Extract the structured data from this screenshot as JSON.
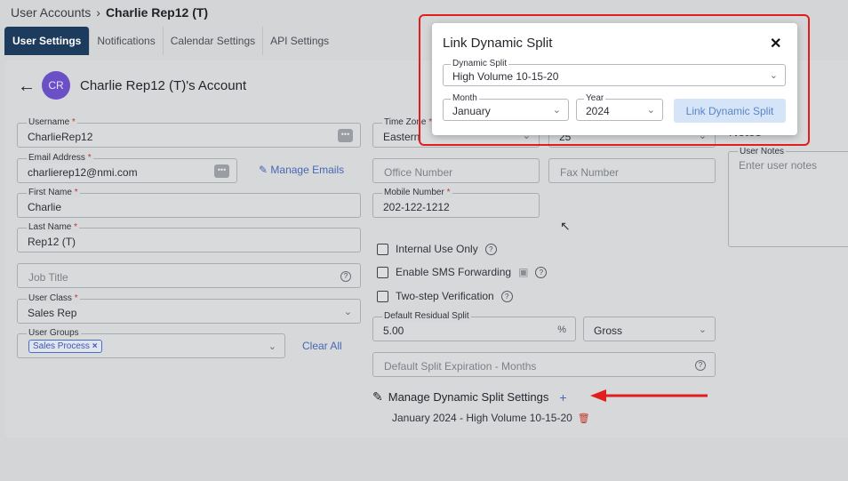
{
  "breadcrumb": {
    "parent": "User Accounts",
    "separator": "›",
    "current": "Charlie Rep12 (T)"
  },
  "tabs": [
    "User Settings",
    "Notifications",
    "Calendar Settings",
    "API Settings"
  ],
  "account": {
    "avatar_initials": "CR",
    "title": "Charlie Rep12 (T)'s Account"
  },
  "left": {
    "username": {
      "label": "Username",
      "value": "CharlieRep12"
    },
    "email": {
      "label": "Email Address",
      "value": "charlierep12@nmi.com"
    },
    "manage_emails": "Manage Emails",
    "first_name": {
      "label": "First Name",
      "value": "Charlie"
    },
    "last_name": {
      "label": "Last Name",
      "value": "Rep12 (T)"
    },
    "job_title": {
      "placeholder": "Job Title"
    },
    "user_class": {
      "label": "User Class",
      "value": "Sales Rep"
    },
    "user_groups": {
      "label": "User Groups",
      "tag": "Sales Process"
    },
    "clear_all": "Clear All"
  },
  "middle": {
    "time_zone": {
      "label": "Time Zone",
      "value": "Eastern"
    },
    "second_value": "25",
    "office_number": {
      "placeholder": "Office Number"
    },
    "fax_number": {
      "placeholder": "Fax Number"
    },
    "mobile_number": {
      "label": "Mobile Number",
      "value": "202-122-1212"
    },
    "checkboxes": [
      "Internal Use Only",
      "Enable SMS Forwarding",
      "Two-step Verification"
    ],
    "residual_split": {
      "label": "Default Residual Split",
      "value": "5.00",
      "unit": "%"
    },
    "gross": "Gross",
    "split_expiration": {
      "placeholder": "Default Split Expiration - Months"
    },
    "manage_dynamic": "Manage Dynamic Split Settings",
    "plus": "+",
    "dynamic_entry": "January 2024 - High Volume 10-15-20"
  },
  "notes": {
    "heading": "Notes",
    "label": "User Notes",
    "placeholder": "Enter user notes"
  },
  "modal": {
    "title": "Link Dynamic Split",
    "close": "✕",
    "dynamic_split": {
      "label": "Dynamic Split",
      "value": "High Volume 10-15-20"
    },
    "month": {
      "label": "Month",
      "value": "January"
    },
    "year": {
      "label": "Year",
      "value": "2024"
    },
    "link_button": "Link Dynamic Split"
  },
  "colors": {
    "tab_active": "#1d3b5c",
    "accent": "#4867b5",
    "highlight": "#e21d1d",
    "avatar": "#6a4fc7"
  }
}
